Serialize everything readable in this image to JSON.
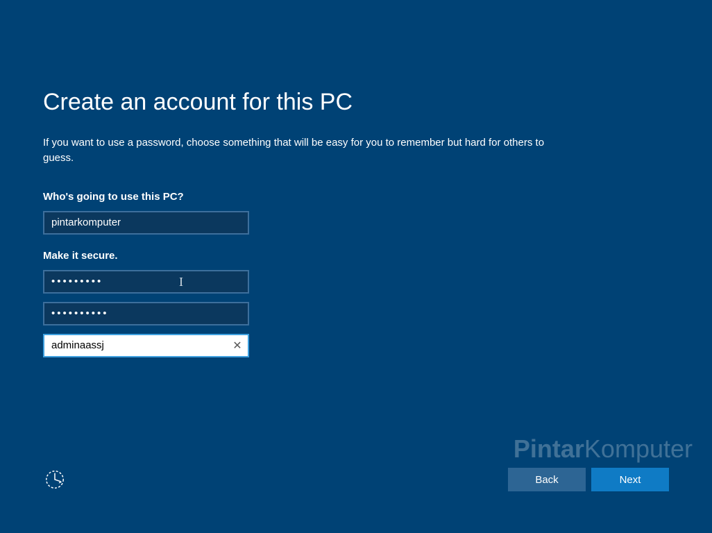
{
  "title": "Create an account for this PC",
  "description": "If you want to use a password, choose something that will be easy for you to remember but hard for others to guess.",
  "labels": {
    "who": "Who's going to use this PC?",
    "secure": "Make it secure."
  },
  "fields": {
    "username": "pintarkomputer",
    "password": "•••••••••",
    "confirm_password": "••••••••••",
    "hint": "adminaassj"
  },
  "buttons": {
    "back": "Back",
    "next": "Next",
    "clear": "✕"
  },
  "watermark": {
    "bold": "Pintar",
    "rest": "Komputer"
  }
}
